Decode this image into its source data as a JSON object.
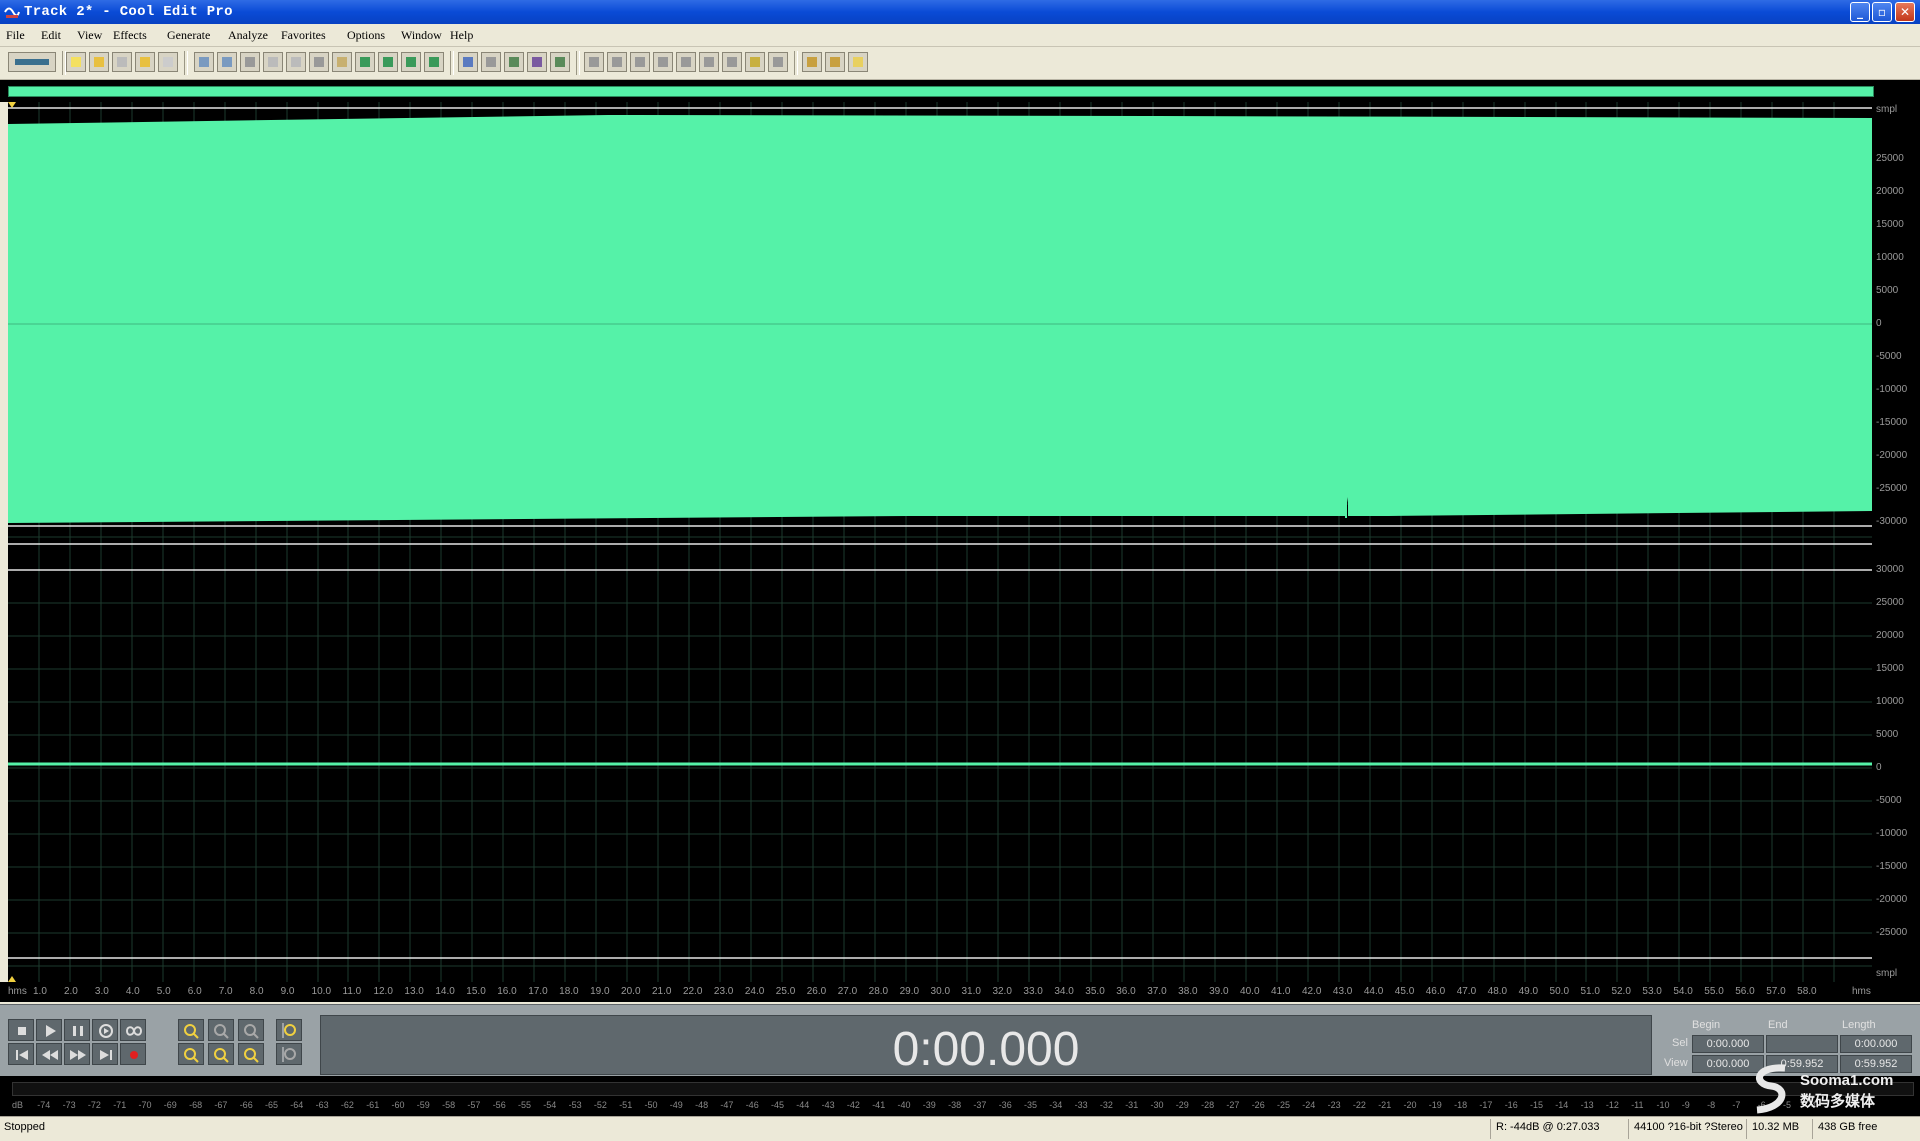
{
  "window": {
    "title": "Track 2* - Cool Edit Pro",
    "minimize_label": "_",
    "maximize_label": "▫",
    "close_label": "✕"
  },
  "menu": [
    "File",
    "Edit",
    "View",
    "Effects",
    "Generate",
    "Analyze",
    "Favorites",
    "Options",
    "Window",
    "Help"
  ],
  "colors": {
    "waveform": "#55f2a8",
    "background": "#000000",
    "grid": "#1d3a2e",
    "ruler_text": "#9a9a9a"
  },
  "amplitude_ruler": {
    "unit": "smpl",
    "channel1": [
      "25000",
      "20000",
      "15000",
      "10000",
      "5000",
      "0",
      "-5000",
      "-10000",
      "-15000",
      "-20000",
      "-25000",
      "-30000"
    ],
    "channel2": [
      "30000",
      "25000",
      "20000",
      "15000",
      "10000",
      "5000",
      "0",
      "-5000",
      "-10000",
      "-15000",
      "-20000",
      "-25000"
    ],
    "bottom_unit": "smpl"
  },
  "timeline": {
    "unit_left": "hms",
    "unit_right": "hms",
    "labels": [
      "1.0",
      "2.0",
      "3.0",
      "4.0",
      "5.0",
      "6.0",
      "7.0",
      "8.0",
      "9.0",
      "10.0",
      "11.0",
      "12.0",
      "13.0",
      "14.0",
      "15.0",
      "16.0",
      "17.0",
      "18.0",
      "19.0",
      "20.0",
      "21.0",
      "22.0",
      "23.0",
      "24.0",
      "25.0",
      "26.0",
      "27.0",
      "28.0",
      "29.0",
      "30.0",
      "31.0",
      "32.0",
      "33.0",
      "34.0",
      "35.0",
      "36.0",
      "37.0",
      "38.0",
      "39.0",
      "40.0",
      "41.0",
      "42.0",
      "43.0",
      "44.0",
      "45.0",
      "46.0",
      "47.0",
      "48.0",
      "49.0",
      "50.0",
      "51.0",
      "52.0",
      "53.0",
      "54.0",
      "55.0",
      "56.0",
      "57.0",
      "58.0"
    ]
  },
  "transport": {
    "time": "0:00.000"
  },
  "selection": {
    "begin_header": "Begin",
    "end_header": "End",
    "length_header": "Length",
    "sel_label": "Sel",
    "view_label": "View",
    "sel_begin": "0:00.000",
    "sel_end": "",
    "sel_length": "0:00.000",
    "view_begin": "0:00.000",
    "view_end": "0:59.952",
    "view_length": "0:59.952"
  },
  "level_meter": {
    "labels": [
      "dB",
      "-74",
      "-73",
      "-72",
      "-71",
      "-70",
      "-69",
      "-68",
      "-67",
      "-66",
      "-65",
      "-64",
      "-63",
      "-62",
      "-61",
      "-60",
      "-59",
      "-58",
      "-57",
      "-56",
      "-55",
      "-54",
      "-53",
      "-52",
      "-51",
      "-50",
      "-49",
      "-48",
      "-47",
      "-46",
      "-45",
      "-44",
      "-43",
      "-42",
      "-41",
      "-40",
      "-39",
      "-38",
      "-37",
      "-36",
      "-35",
      "-34",
      "-33",
      "-32",
      "-31",
      "-30",
      "-29",
      "-28",
      "-27",
      "-26",
      "-25",
      "-24",
      "-23",
      "-22",
      "-21",
      "-20",
      "-19",
      "-18",
      "-17",
      "-16",
      "-15",
      "-14",
      "-13",
      "-12",
      "-11",
      "-10",
      "-9",
      "-8",
      "-7",
      "-6",
      "-5",
      "-4"
    ]
  },
  "status": {
    "state": "Stopped",
    "cursor": "R: -44dB @  0:27.033",
    "format": "44100 ?16-bit ?Stereo",
    "size": "10.32 MB",
    "free": "438 GB free"
  },
  "watermark": {
    "line1": "Sooma1.com",
    "line2": "数码多媒体"
  }
}
